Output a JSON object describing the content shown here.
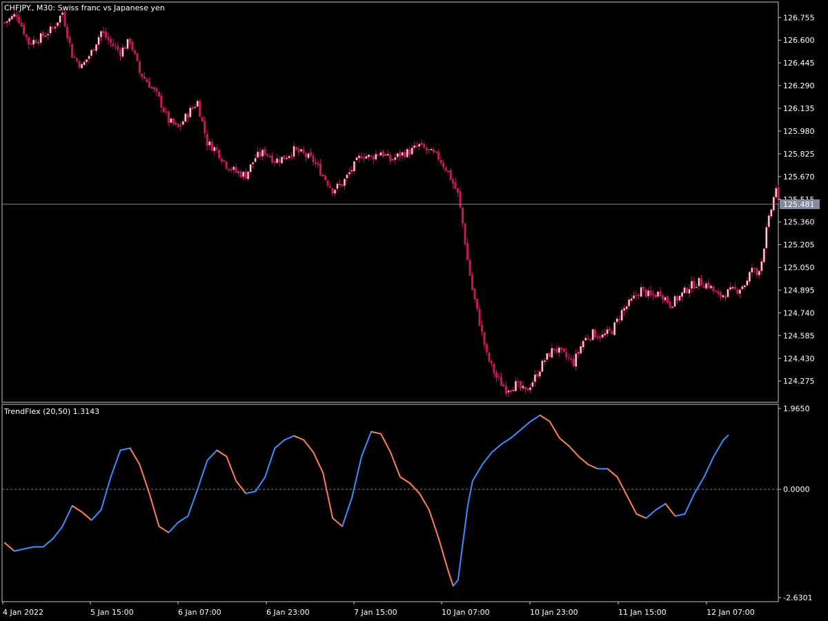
{
  "window": {
    "main_title": "CHFJPY., M30:  Swiss franc vs Japanese yen",
    "indicator_title": "TrendFlex (20,50) 1.3143"
  },
  "colors": {
    "background": "#000000",
    "frame": "#c8c8c8",
    "candle": "#c2185b",
    "candle_up_body": "#f8d7da",
    "price_line": "#7f8c9f",
    "price_tag_bg": "#7f8c9f",
    "indicator_up": "#3a8fff",
    "indicator_down": "#ff7f50",
    "zero_line": "#888888"
  },
  "chart_data": [
    {
      "type": "candlestick",
      "title": "CHFJPY., M30:  Swiss franc vs Japanese yen",
      "ylim": [
        124.13,
        126.86
      ],
      "y_ticks": [
        "126.755",
        "126.600",
        "126.445",
        "126.290",
        "126.135",
        "125.980",
        "125.825",
        "125.670",
        "125.515",
        "125.360",
        "125.205",
        "125.050",
        "124.895",
        "124.740",
        "124.585",
        "124.430",
        "124.275"
      ],
      "current_price": "125.481",
      "close_path": [
        {
          "i": 0,
          "v": 126.72
        },
        {
          "i": 5,
          "v": 126.78
        },
        {
          "i": 10,
          "v": 126.58
        },
        {
          "i": 15,
          "v": 126.62
        },
        {
          "i": 20,
          "v": 126.68
        },
        {
          "i": 24,
          "v": 126.79
        },
        {
          "i": 28,
          "v": 126.5
        },
        {
          "i": 32,
          "v": 126.42
        },
        {
          "i": 36,
          "v": 126.52
        },
        {
          "i": 40,
          "v": 126.66
        },
        {
          "i": 44,
          "v": 126.58
        },
        {
          "i": 48,
          "v": 126.52
        },
        {
          "i": 52,
          "v": 126.6
        },
        {
          "i": 56,
          "v": 126.38
        },
        {
          "i": 60,
          "v": 126.3
        },
        {
          "i": 64,
          "v": 126.2
        },
        {
          "i": 68,
          "v": 126.05
        },
        {
          "i": 72,
          "v": 126.0
        },
        {
          "i": 76,
          "v": 126.1
        },
        {
          "i": 80,
          "v": 126.18
        },
        {
          "i": 84,
          "v": 125.9
        },
        {
          "i": 88,
          "v": 125.85
        },
        {
          "i": 92,
          "v": 125.75
        },
        {
          "i": 96,
          "v": 125.7
        },
        {
          "i": 100,
          "v": 125.68
        },
        {
          "i": 104,
          "v": 125.8
        },
        {
          "i": 108,
          "v": 125.84
        },
        {
          "i": 112,
          "v": 125.78
        },
        {
          "i": 116,
          "v": 125.8
        },
        {
          "i": 120,
          "v": 125.85
        },
        {
          "i": 124,
          "v": 125.82
        },
        {
          "i": 128,
          "v": 125.78
        },
        {
          "i": 132,
          "v": 125.68
        },
        {
          "i": 136,
          "v": 125.58
        },
        {
          "i": 140,
          "v": 125.62
        },
        {
          "i": 144,
          "v": 125.72
        },
        {
          "i": 148,
          "v": 125.82
        },
        {
          "i": 152,
          "v": 125.8
        },
        {
          "i": 156,
          "v": 125.84
        },
        {
          "i": 160,
          "v": 125.78
        },
        {
          "i": 164,
          "v": 125.82
        },
        {
          "i": 168,
          "v": 125.84
        },
        {
          "i": 172,
          "v": 125.88
        },
        {
          "i": 176,
          "v": 125.84
        },
        {
          "i": 180,
          "v": 125.8
        },
        {
          "i": 184,
          "v": 125.7
        },
        {
          "i": 188,
          "v": 125.55
        },
        {
          "i": 190,
          "v": 125.35
        },
        {
          "i": 192,
          "v": 125.1
        },
        {
          "i": 194,
          "v": 124.9
        },
        {
          "i": 196,
          "v": 124.75
        },
        {
          "i": 198,
          "v": 124.6
        },
        {
          "i": 200,
          "v": 124.45
        },
        {
          "i": 204,
          "v": 124.3
        },
        {
          "i": 208,
          "v": 124.22
        },
        {
          "i": 212,
          "v": 124.25
        },
        {
          "i": 216,
          "v": 124.2
        },
        {
          "i": 220,
          "v": 124.3
        },
        {
          "i": 224,
          "v": 124.42
        },
        {
          "i": 228,
          "v": 124.5
        },
        {
          "i": 232,
          "v": 124.45
        },
        {
          "i": 236,
          "v": 124.4
        },
        {
          "i": 240,
          "v": 124.55
        },
        {
          "i": 244,
          "v": 124.6
        },
        {
          "i": 248,
          "v": 124.58
        },
        {
          "i": 252,
          "v": 124.62
        },
        {
          "i": 256,
          "v": 124.75
        },
        {
          "i": 260,
          "v": 124.82
        },
        {
          "i": 264,
          "v": 124.9
        },
        {
          "i": 268,
          "v": 124.85
        },
        {
          "i": 272,
          "v": 124.88
        },
        {
          "i": 276,
          "v": 124.8
        },
        {
          "i": 280,
          "v": 124.85
        },
        {
          "i": 284,
          "v": 124.92
        },
        {
          "i": 288,
          "v": 124.95
        },
        {
          "i": 292,
          "v": 124.93
        },
        {
          "i": 296,
          "v": 124.85
        },
        {
          "i": 300,
          "v": 124.88
        },
        {
          "i": 304,
          "v": 124.9
        },
        {
          "i": 308,
          "v": 124.95
        },
        {
          "i": 310,
          "v": 125.05
        },
        {
          "i": 312,
          "v": 125.0
        },
        {
          "i": 314,
          "v": 125.1
        },
        {
          "i": 316,
          "v": 125.3
        },
        {
          "i": 318,
          "v": 125.45
        },
        {
          "i": 320,
          "v": 125.6
        },
        {
          "i": 321,
          "v": 125.48
        }
      ]
    },
    {
      "type": "line",
      "title": "TrendFlex (20,50) 1.3143",
      "ylim": [
        -2.6301,
        1.965
      ],
      "y_ticks": [
        "1.9650",
        "0.0000",
        "-2.6301"
      ],
      "zero_line": 0,
      "points": [
        {
          "i": 0,
          "v": -1.3
        },
        {
          "i": 4,
          "v": -1.5
        },
        {
          "i": 8,
          "v": -1.45
        },
        {
          "i": 12,
          "v": -1.4
        },
        {
          "i": 16,
          "v": -1.4
        },
        {
          "i": 20,
          "v": -1.2
        },
        {
          "i": 24,
          "v": -0.9
        },
        {
          "i": 28,
          "v": -0.4
        },
        {
          "i": 32,
          "v": -0.55
        },
        {
          "i": 36,
          "v": -0.75
        },
        {
          "i": 40,
          "v": -0.5
        },
        {
          "i": 44,
          "v": 0.3
        },
        {
          "i": 48,
          "v": 0.95
        },
        {
          "i": 52,
          "v": 1.0
        },
        {
          "i": 56,
          "v": 0.6
        },
        {
          "i": 60,
          "v": -0.1
        },
        {
          "i": 64,
          "v": -0.9
        },
        {
          "i": 68,
          "v": -1.05
        },
        {
          "i": 72,
          "v": -0.8
        },
        {
          "i": 76,
          "v": -0.65
        },
        {
          "i": 80,
          "v": 0.0
        },
        {
          "i": 84,
          "v": 0.7
        },
        {
          "i": 88,
          "v": 0.95
        },
        {
          "i": 92,
          "v": 0.8
        },
        {
          "i": 96,
          "v": 0.2
        },
        {
          "i": 100,
          "v": -0.1
        },
        {
          "i": 104,
          "v": -0.05
        },
        {
          "i": 108,
          "v": 0.3
        },
        {
          "i": 112,
          "v": 1.0
        },
        {
          "i": 116,
          "v": 1.2
        },
        {
          "i": 120,
          "v": 1.3
        },
        {
          "i": 124,
          "v": 1.2
        },
        {
          "i": 128,
          "v": 0.9
        },
        {
          "i": 132,
          "v": 0.4
        },
        {
          "i": 136,
          "v": -0.7
        },
        {
          "i": 140,
          "v": -0.9
        },
        {
          "i": 144,
          "v": -0.2
        },
        {
          "i": 148,
          "v": 0.8
        },
        {
          "i": 152,
          "v": 1.4
        },
        {
          "i": 156,
          "v": 1.35
        },
        {
          "i": 160,
          "v": 0.9
        },
        {
          "i": 164,
          "v": 0.3
        },
        {
          "i": 168,
          "v": 0.15
        },
        {
          "i": 172,
          "v": -0.1
        },
        {
          "i": 176,
          "v": -0.5
        },
        {
          "i": 180,
          "v": -1.2
        },
        {
          "i": 184,
          "v": -2.0
        },
        {
          "i": 186,
          "v": -2.35
        },
        {
          "i": 188,
          "v": -2.2
        },
        {
          "i": 190,
          "v": -1.3
        },
        {
          "i": 192,
          "v": -0.4
        },
        {
          "i": 194,
          "v": 0.2
        },
        {
          "i": 198,
          "v": 0.6
        },
        {
          "i": 202,
          "v": 0.9
        },
        {
          "i": 206,
          "v": 1.1
        },
        {
          "i": 210,
          "v": 1.25
        },
        {
          "i": 214,
          "v": 1.45
        },
        {
          "i": 218,
          "v": 1.65
        },
        {
          "i": 222,
          "v": 1.8
        },
        {
          "i": 226,
          "v": 1.65
        },
        {
          "i": 230,
          "v": 1.25
        },
        {
          "i": 234,
          "v": 1.05
        },
        {
          "i": 238,
          "v": 0.8
        },
        {
          "i": 242,
          "v": 0.6
        },
        {
          "i": 246,
          "v": 0.5
        },
        {
          "i": 250,
          "v": 0.5
        },
        {
          "i": 254,
          "v": 0.3
        },
        {
          "i": 258,
          "v": -0.15
        },
        {
          "i": 262,
          "v": -0.6
        },
        {
          "i": 266,
          "v": -0.7
        },
        {
          "i": 270,
          "v": -0.5
        },
        {
          "i": 274,
          "v": -0.35
        },
        {
          "i": 278,
          "v": -0.65
        },
        {
          "i": 282,
          "v": -0.6
        },
        {
          "i": 286,
          "v": -0.1
        },
        {
          "i": 290,
          "v": 0.3
        },
        {
          "i": 294,
          "v": 0.8
        },
        {
          "i": 298,
          "v": 1.2
        },
        {
          "i": 300,
          "v": 1.3143
        }
      ]
    }
  ],
  "x_axis": {
    "labels": [
      "4 Jan 2022",
      "5 Jan 15:00",
      "6 Jan 07:00",
      "6 Jan 23:00",
      "7 Jan 15:00",
      "10 Jan 07:00",
      "10 Jan 23:00",
      "11 Jan 15:00",
      "12 Jan 07:00"
    ]
  }
}
